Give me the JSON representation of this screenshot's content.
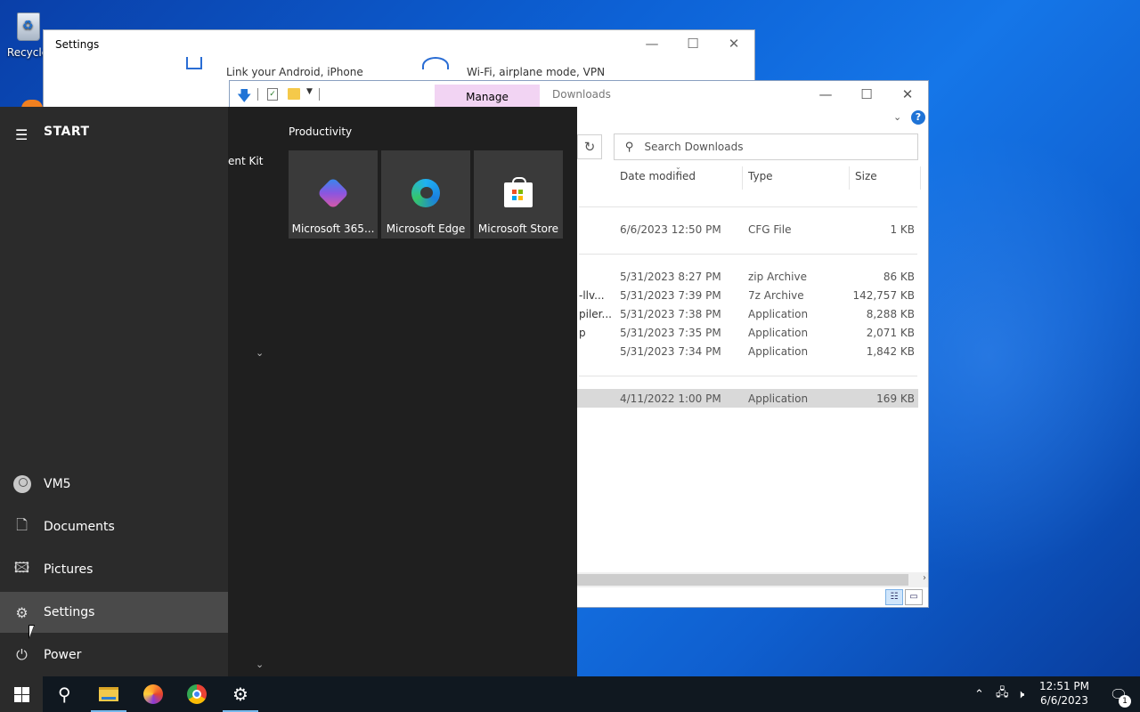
{
  "desktop": {
    "recycle_label": "Recycle"
  },
  "settings_window": {
    "title": "Settings",
    "tile1_text": "Link your Android, iPhone",
    "tile2_text": "Wi-Fi, airplane mode, VPN",
    "minimize": "—",
    "maximize": "☐",
    "close": "✕"
  },
  "explorer": {
    "manage_tab": "Manage",
    "title": "Downloads",
    "search_placeholder": "Search Downloads",
    "refresh_icon": "↻",
    "minimize": "—",
    "maximize": "☐",
    "close": "✕",
    "help": "?",
    "columns": {
      "date": "Date modified",
      "type": "Type",
      "size": "Size"
    },
    "rows": [
      {
        "name": "",
        "date": "6/6/2023 12:50 PM",
        "type": "CFG File",
        "size": "1 KB"
      },
      {
        "name": "",
        "date": "5/31/2023 8:27 PM",
        "type": "zip Archive",
        "size": "86 KB"
      },
      {
        "name": "-llv...",
        "date": "5/31/2023 7:39 PM",
        "type": "7z Archive",
        "size": "142,757 KB"
      },
      {
        "name": "piler...",
        "date": "5/31/2023 7:38 PM",
        "type": "Application",
        "size": "8,288 KB"
      },
      {
        "name": "p",
        "date": "5/31/2023 7:35 PM",
        "type": "Application",
        "size": "2,071 KB"
      },
      {
        "name": "",
        "date": "5/31/2023 7:34 PM",
        "type": "Application",
        "size": "1,842 KB"
      },
      {
        "name": "",
        "date": "4/11/2022 1:00 PM",
        "type": "Application",
        "size": "169 KB"
      }
    ]
  },
  "start_menu": {
    "title": "START",
    "left_items": [
      {
        "label": "VM5"
      },
      {
        "label": "Documents"
      },
      {
        "label": "Pictures"
      },
      {
        "label": "Settings"
      },
      {
        "label": "Power"
      }
    ],
    "partial_app_text": "ent Kit",
    "group_title": "Productivity",
    "tiles": [
      {
        "label": "Microsoft 365..."
      },
      {
        "label": "Microsoft Edge"
      },
      {
        "label": "Microsoft Store"
      }
    ]
  },
  "taskbar": {
    "time": "12:51 PM",
    "date": "6/6/2023",
    "notification_count": "1"
  }
}
